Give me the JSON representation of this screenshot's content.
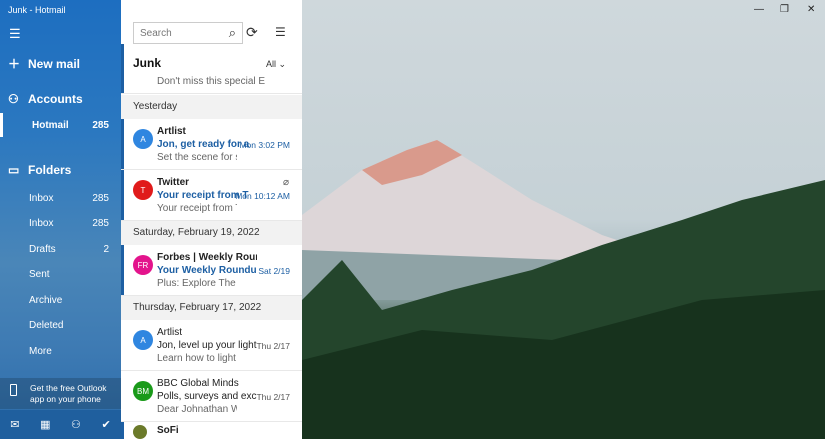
{
  "window": {
    "title": "Junk - Hotmail",
    "minimize": "—",
    "maximize": "❐",
    "close": "✕"
  },
  "sidebar": {
    "new_mail": "New mail",
    "accounts": "Accounts",
    "account": {
      "name": "Hotmail",
      "count": "285"
    },
    "folders_label": "Folders",
    "folders": [
      {
        "label": "Inbox",
        "count": "285"
      },
      {
        "label": "Inbox",
        "count": "285"
      },
      {
        "label": "Drafts",
        "count": "2"
      },
      {
        "label": "Sent",
        "count": ""
      },
      {
        "label": "Archive",
        "count": ""
      },
      {
        "label": "Deleted",
        "count": ""
      },
      {
        "label": "More",
        "count": ""
      }
    ],
    "promo": "Get the free Outlook app on your phone"
  },
  "list": {
    "search_placeholder": "Search",
    "folder": "Junk",
    "filter": "All",
    "partial_preview": "Don't miss this special E",
    "groups": [
      {
        "header": "Yesterday",
        "messages": [
          {
            "initials": "A",
            "color": "#2f86e0",
            "from": "Artlist",
            "subject": "Jon, get ready for a",
            "time": "Mon 3:02 PM",
            "preview": "Set the scene for sor",
            "unread": true
          },
          {
            "initials": "T",
            "color": "#e01b1b",
            "from": "Twitter",
            "subject": "Your receipt from T",
            "time": "Mon 10:12 AM",
            "preview": "Your receipt from T",
            "unread": true,
            "attachment": true
          }
        ]
      },
      {
        "header": "Saturday, February 19, 2022",
        "messages": [
          {
            "initials": "FR",
            "color": "#e3148c",
            "from": "Forbes | Weekly Roundup",
            "subject": "Your Weekly Roundup",
            "time": "Sat 2/19",
            "preview": "Plus: Explore The Latest I",
            "unread": true
          }
        ]
      },
      {
        "header": "Thursday, February 17, 2022",
        "messages": [
          {
            "initials": "A",
            "color": "#2f86e0",
            "from": "Artlist",
            "subject": "Jon, level up your lighting",
            "time": "Thu 2/17",
            "preview": "Learn how to light your",
            "unread": false
          },
          {
            "initials": "BM",
            "color": "#1a9a1a",
            "from": "BBC Global Minds",
            "subject": "Polls, surveys and exclusive",
            "time": "Thu 2/17",
            "preview": "Dear Johnathan We hop",
            "unread": false
          },
          {
            "initials": "",
            "color": "#6b7a2a",
            "from": "SoFi",
            "subject": "",
            "time": "",
            "preview": "",
            "unread": true
          }
        ]
      }
    ]
  }
}
